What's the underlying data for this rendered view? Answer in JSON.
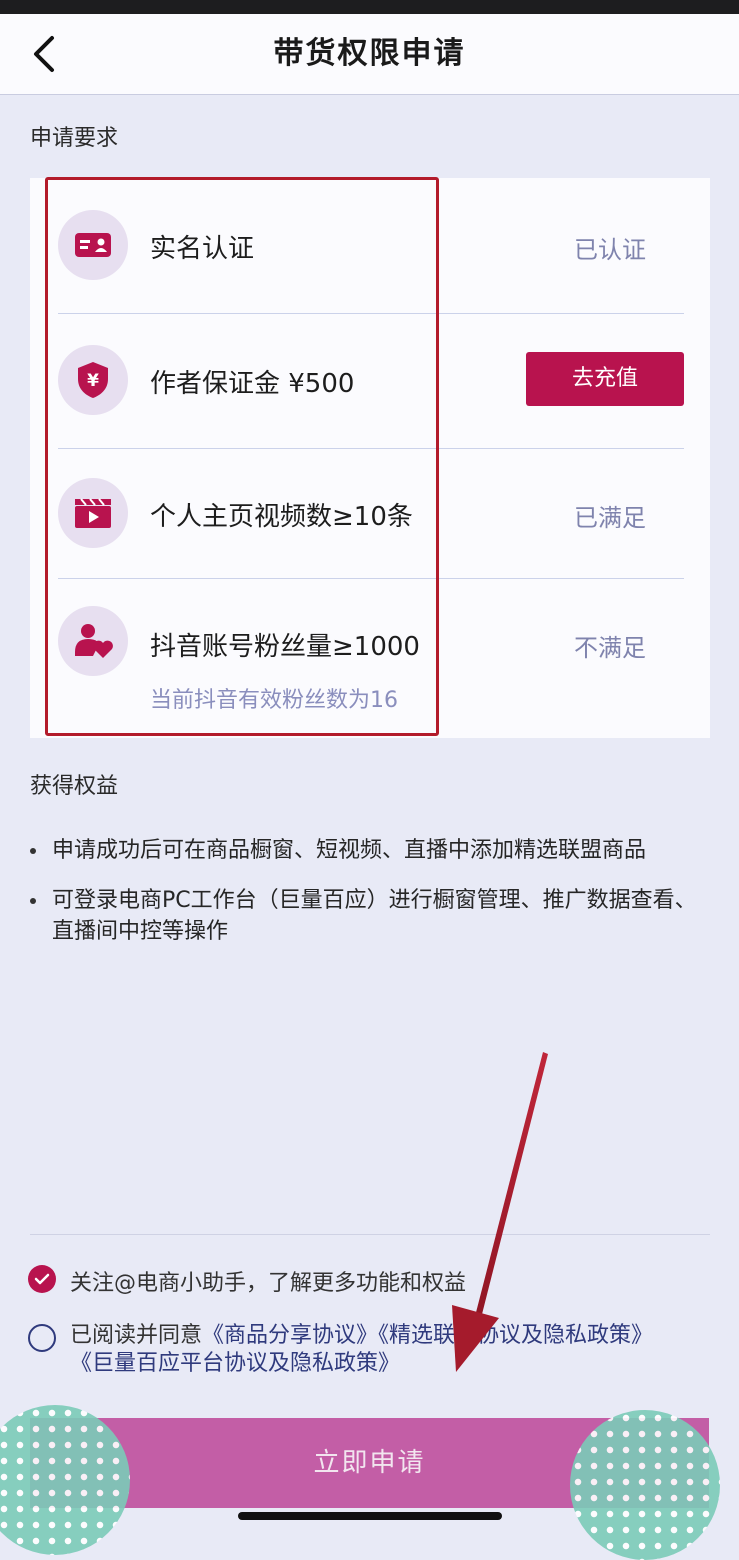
{
  "header": {
    "title": "带货权限申请"
  },
  "requirements": {
    "section_title": "申请要求",
    "items": [
      {
        "title": "实名认证",
        "status": "已认证",
        "icon": "id-card-icon"
      },
      {
        "title": "作者保证金 ¥500",
        "action": "去充值",
        "icon": "shield-yen-icon"
      },
      {
        "title": "个人主页视频数≥10条",
        "status": "已满足",
        "icon": "clapperboard-icon"
      },
      {
        "title": "抖音账号粉丝量≥1000",
        "subtitle": "当前抖音有效粉丝数为16",
        "status": "不满足",
        "icon": "user-heart-icon"
      }
    ]
  },
  "benefits": {
    "section_title": "获得权益",
    "items": [
      "申请成功后可在商品橱窗、短视频、直播中添加精选联盟商品",
      "可登录电商PC工作台（巨量百应）进行橱窗管理、推广数据查看、直播间中控等操作"
    ]
  },
  "agreements": {
    "follow": {
      "text": "关注@电商小助手，了解更多功能和权益",
      "checked": true
    },
    "terms": {
      "prefix": "已阅读并同意",
      "link1": "《商品分享协议》",
      "link2": "《精选联盟协议及隐私政策》",
      "link3": "《巨量百应平台协议及隐私政策》",
      "checked": false
    }
  },
  "apply_button": "立即申请",
  "colors": {
    "accent": "#b8134e",
    "apply_button": "#c35ea6",
    "background": "#e8eaf6",
    "annotation": "#b31b2b"
  }
}
